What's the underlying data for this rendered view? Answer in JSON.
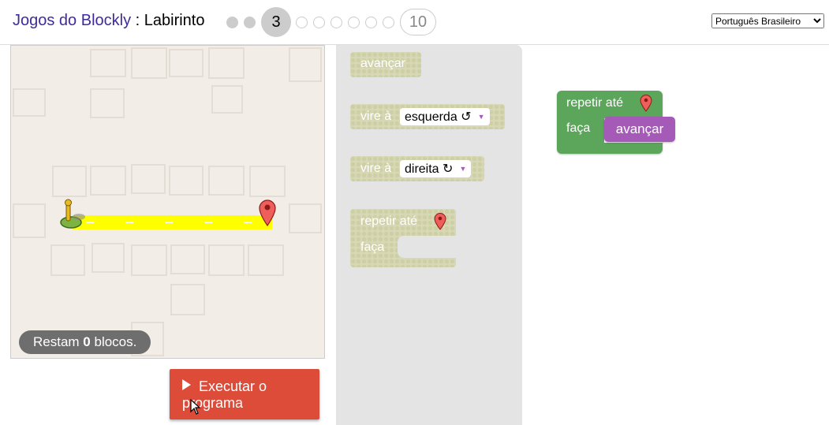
{
  "header": {
    "app_title": "Jogos do Blockly",
    "separator": " : ",
    "game_title": "Labirinto",
    "levels": {
      "current": "3",
      "last": "10"
    },
    "language": {
      "selected": "Português Brasileiro"
    }
  },
  "maze": {
    "blocks_remaining": {
      "prefix": "Restam ",
      "count": "0",
      "suffix": " blocos."
    },
    "colors": {
      "path": "#ffff00",
      "background": "#f2ede6",
      "marker": "#ee5f5b",
      "pegman": "#e8b923"
    }
  },
  "run_button": {
    "label": "Executar o programa"
  },
  "toolbox": {
    "move_forward": "avançar",
    "turn_left": {
      "label": "vire à",
      "value": "esquerda ↺"
    },
    "turn_right": {
      "label": "vire à",
      "value": "direita ↻"
    },
    "repeat": {
      "label": "repetir até",
      "do_label": "faça"
    }
  },
  "workspace": {
    "repeat": {
      "label": "repetir até",
      "do_label": "faça",
      "inner_block": "avançar"
    },
    "colors": {
      "loop": "#5ca65c",
      "movement": "#a55ab7"
    }
  }
}
